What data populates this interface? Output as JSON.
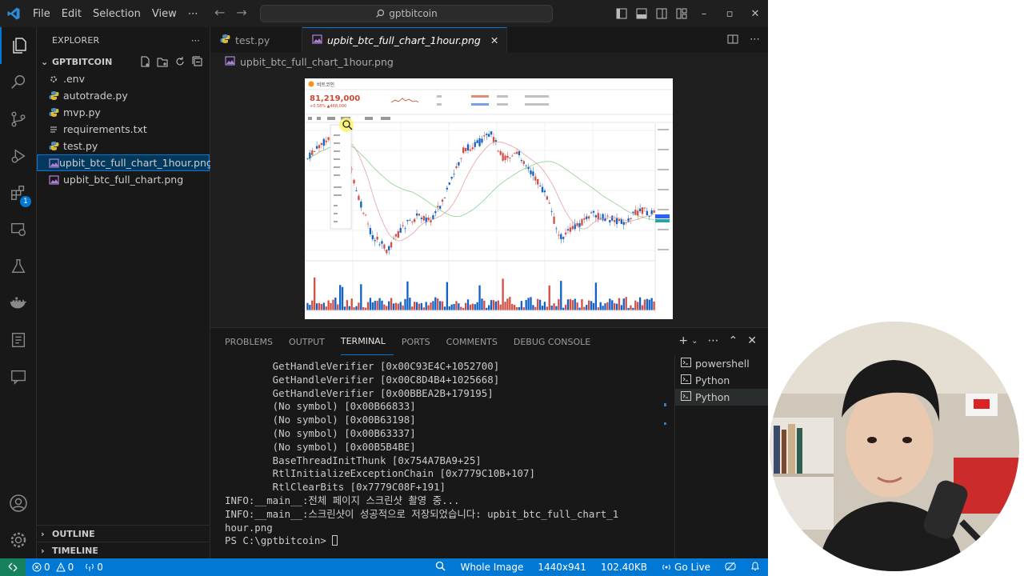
{
  "titlebar": {
    "menu": [
      "File",
      "Edit",
      "Selection",
      "View",
      "⋯"
    ],
    "search": "gptbitcoin"
  },
  "activitybar": {
    "extensions_badge": "1"
  },
  "sidebar": {
    "header": "EXPLORER",
    "folder": "GPTBITCOIN",
    "files": [
      {
        "name": ".env",
        "icon": "env-icon"
      },
      {
        "name": "autotrade.py",
        "icon": "python-icon"
      },
      {
        "name": "mvp.py",
        "icon": "python-icon"
      },
      {
        "name": "requirements.txt",
        "icon": "text-icon"
      },
      {
        "name": "test.py",
        "icon": "python-icon"
      },
      {
        "name": "upbit_btc_full_chart_1hour.png",
        "icon": "image-icon",
        "selected": true
      },
      {
        "name": "upbit_btc_full_chart.png",
        "icon": "image-icon"
      }
    ],
    "outline": "OUTLINE",
    "timeline": "TIMELINE"
  },
  "editor": {
    "tabs": [
      {
        "label": "test.py",
        "active": false
      },
      {
        "label": "upbit_btc_full_chart_1hour.png",
        "active": true
      }
    ],
    "breadcrumb": "upbit_btc_full_chart_1hour.png"
  },
  "screenshot_chart": {
    "coin_name": "비트코인",
    "price": "81,219,000",
    "change": "+0.58% ▲468,000"
  },
  "panel": {
    "tabs": [
      "PROBLEMS",
      "OUTPUT",
      "TERMINAL",
      "PORTS",
      "COMMENTS",
      "DEBUG CONSOLE"
    ],
    "active_tab": "TERMINAL",
    "terminal_lines": [
      "        GetHandleVerifier [0x00C93E4C+1052700]",
      "        GetHandleVerifier [0x00C8D4B4+1025668]",
      "        GetHandleVerifier [0x00BBEA2B+179195]",
      "        (No symbol) [0x00B66833]",
      "        (No symbol) [0x00B63198]",
      "        (No symbol) [0x00B63337]",
      "        (No symbol) [0x00B5B4BE]",
      "        BaseThreadInitThunk [0x754A7BA9+25]",
      "        RtlInitializeExceptionChain [0x7779C10B+107]",
      "        RtlClearBits [0x7779C08F+191]",
      "",
      "INFO:__main__:전체 페이지 스크린샷 촬영 중...",
      "INFO:__main__:스크린샷이 성공적으로 저장되었습니다: upbit_btc_full_chart_1",
      "hour.png",
      "PS C:\\gptbitcoin> "
    ],
    "terminals": [
      "powershell",
      "Python",
      "Python"
    ]
  },
  "statusbar": {
    "errors": "0",
    "warnings": "0",
    "ports": "0",
    "image_mode": "Whole Image",
    "dimensions": "1440x941",
    "size": "102.40KB",
    "go_live": "Go Live"
  },
  "colors": {
    "accent": "#0078d4",
    "background": "#1f1f1f",
    "sidebar": "#181818",
    "remote": "#16825d"
  }
}
